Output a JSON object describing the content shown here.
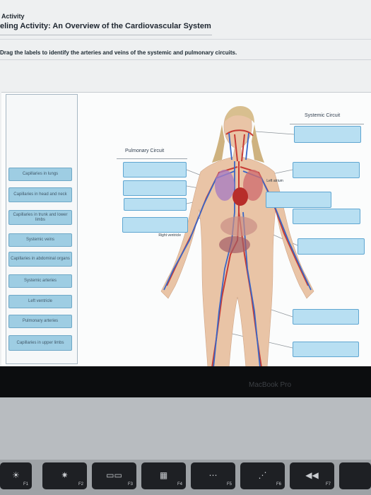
{
  "header": {
    "activity": "Activity",
    "title": "eling Activity: An Overview of the Cardiovascular System",
    "instructions": "Drag the labels to identify the arteries and veins of the systemic and pulmonary circuits."
  },
  "label_bank": [
    "Capillaries in lungs",
    "Capillaries in head and neck",
    "Capillaries in trunk and lower limbs",
    "Systemic veins",
    "Capillaries in abdominal organs",
    "Systemic arteries",
    "Left ventricle",
    "Pulmonary arteries",
    "Capillaries in upper limbs"
  ],
  "diagram": {
    "pulmonary_title": "Pulmonary Circuit",
    "systemic_title": "Systemic Circuit",
    "left_atrium": "Left atrium",
    "right_ventricle": "Right ventricle"
  },
  "laptop": {
    "brand": "MacBook Pro",
    "keys": [
      {
        "glyph": "☀",
        "fn": "F1"
      },
      {
        "glyph": "✷",
        "fn": "F2"
      },
      {
        "glyph": "▭▭",
        "fn": "F3"
      },
      {
        "glyph": "▦",
        "fn": "F4"
      },
      {
        "glyph": "⋯",
        "fn": "F5"
      },
      {
        "glyph": "⋰",
        "fn": "F6"
      },
      {
        "glyph": "◀◀",
        "fn": "F7"
      }
    ]
  },
  "colors": {
    "drop_target": "#b8dff2",
    "label_fill": "#9ecde3",
    "artery": "#c73a34",
    "vein": "#3a67c6"
  }
}
